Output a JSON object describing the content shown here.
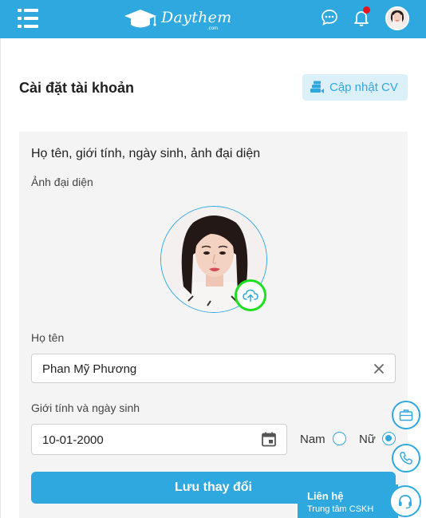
{
  "header": {
    "logo_text": "Daythem",
    "logo_sub": ".com",
    "brand_color": "#2fa8df",
    "notification_dot_color": "#e8141e"
  },
  "page": {
    "title": "Cài đặt tài khoản",
    "cv_button_label": "Cập nhật CV"
  },
  "form": {
    "section_heading": "Họ tên, giới tính, ngày sinh, ảnh đại diện",
    "avatar_label": "Ảnh đại diện",
    "name_label": "Họ tên",
    "name_value": "Phan Mỹ Phương",
    "gender_dob_label": "Giới tính và ngày sinh",
    "dob_value": "10-01-2000",
    "gender_options": [
      {
        "label": "Nam",
        "selected": false
      },
      {
        "label": "Nữ",
        "selected": true
      }
    ],
    "save_button_label": "Lưu thay đổi"
  },
  "contact": {
    "title": "Liên hệ",
    "subtitle": "Trung tâm CSKH"
  },
  "icons": {
    "menu": "menu-icon",
    "chat": "chat-bubble-icon",
    "bell": "bell-icon",
    "upload": "cloud-upload-icon",
    "clear": "close-icon",
    "calendar": "calendar-icon",
    "briefcase": "briefcase-icon",
    "phone": "phone-icon",
    "headset": "headset-icon",
    "cv": "stack-icon"
  }
}
